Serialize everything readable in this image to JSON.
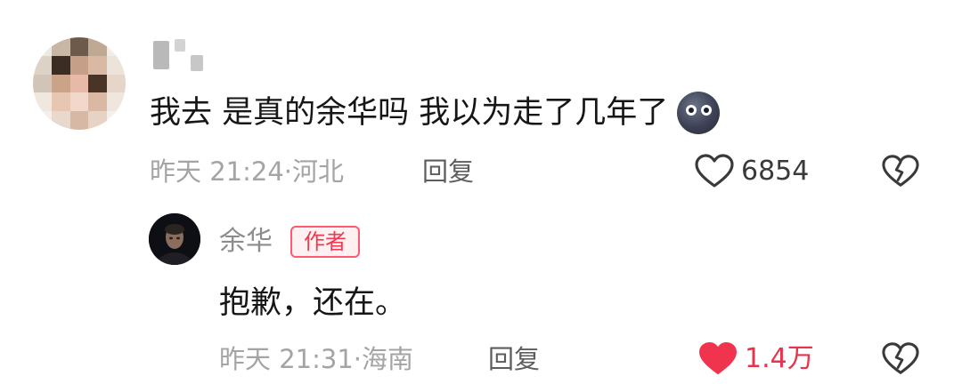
{
  "comment": {
    "text": "我去 是真的余华吗 我以为走了几年了",
    "emoji": "dizzy-face-emoji",
    "time": "昨天 21:24",
    "location": "河北",
    "reply_label": "回复",
    "likes": "6854",
    "liked": false
  },
  "reply": {
    "author": "余华",
    "badge": "作者",
    "text": "抱歉，还在。",
    "time": "昨天 21:31",
    "location": "海南",
    "reply_label": "回复",
    "likes": "1.4万",
    "liked": true
  },
  "separator": "·",
  "colors": {
    "like_active": "#f0344d",
    "meta_gray": "#a4a4a4",
    "badge_red": "#f2394f"
  }
}
